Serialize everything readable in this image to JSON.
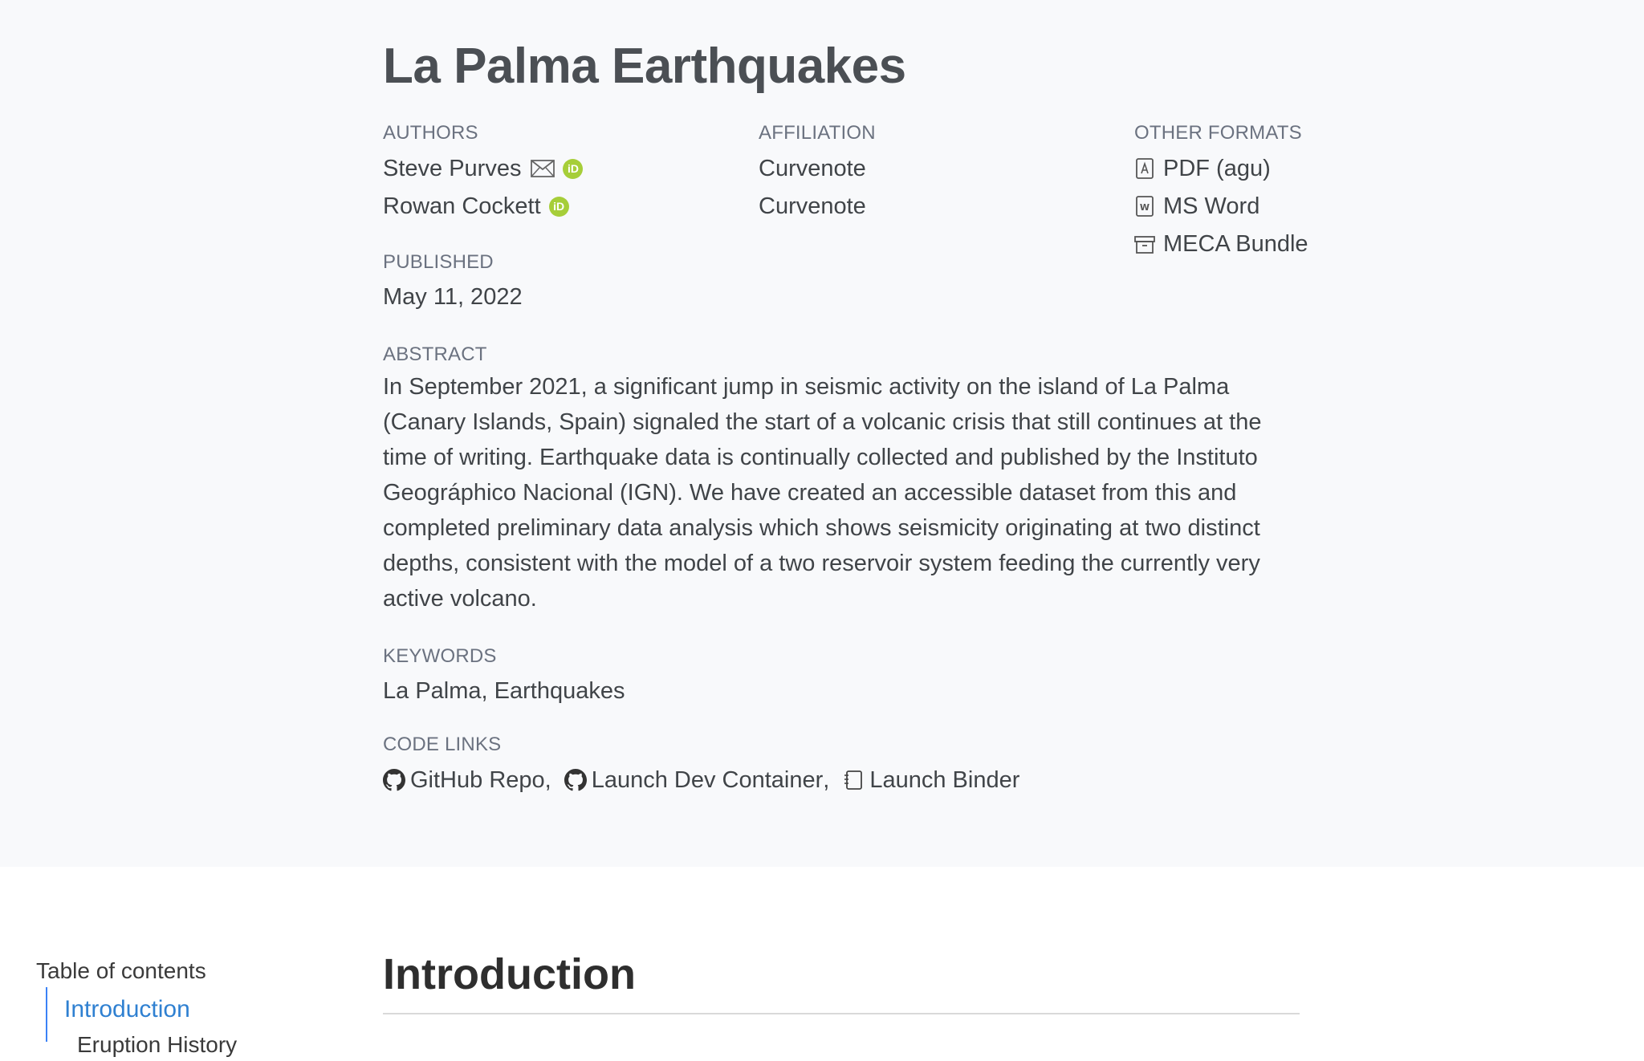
{
  "title": "La Palma Earthquakes",
  "labels": {
    "authors": "AUTHORS",
    "affiliation": "AFFILIATION",
    "other_formats": "OTHER FORMATS",
    "published": "PUBLISHED",
    "abstract": "ABSTRACT",
    "keywords": "KEYWORDS",
    "code_links": "CODE LINKS"
  },
  "authors": [
    {
      "name": "Steve Purves",
      "affiliation": "Curvenote",
      "has_email": true,
      "has_orcid": true
    },
    {
      "name": "Rowan Cockett",
      "affiliation": "Curvenote",
      "has_email": false,
      "has_orcid": true
    }
  ],
  "orcid_glyph": "iD",
  "other_formats": [
    {
      "label": "PDF (agu)",
      "icon": "pdf-file-icon"
    },
    {
      "label": "MS Word",
      "icon": "word-file-icon"
    },
    {
      "label": "MECA Bundle",
      "icon": "archive-box-icon"
    }
  ],
  "published": "May 11, 2022",
  "abstract": "In September 2021, a significant jump in seismic activity on the island of La Palma (Canary Islands, Spain) signaled the start of a volcanic crisis that still continues at the time of writing. Earthquake data is continually collected and published by the Instituto Geográphico Nacional (IGN). We have created an accessible dataset from this and completed preliminary data analysis which shows seismicity originating at two distinct depths, consistent with the model of a two reservoir system feeding the currently very active volcano.",
  "keywords": "La Palma, Earthquakes",
  "code_links": [
    {
      "label": "GitHub Repo",
      "icon": "github-icon",
      "sep": ","
    },
    {
      "label": "Launch Dev Container",
      "icon": "github-icon",
      "sep": ","
    },
    {
      "label": "Launch Binder",
      "icon": "notebook-icon",
      "sep": ""
    }
  ],
  "toc": {
    "title": "Table of contents",
    "items": [
      "Introduction",
      "Eruption History"
    ]
  },
  "section": {
    "heading": "Introduction"
  },
  "colors": {
    "header_bg": "#f8f9fb",
    "link_blue": "#2f80d1",
    "orcid_green": "#a6ce39"
  }
}
